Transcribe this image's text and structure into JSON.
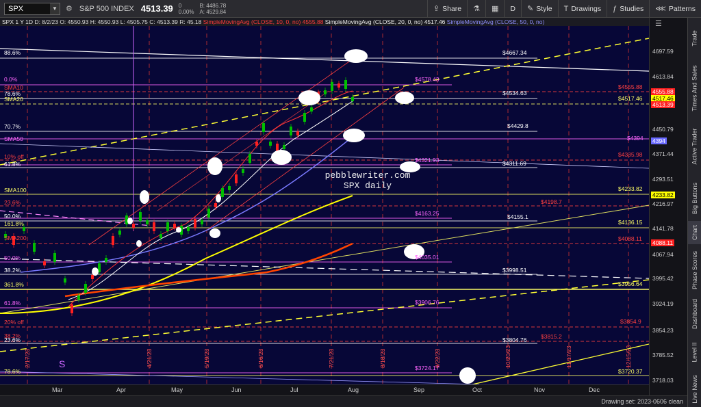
{
  "toolbar": {
    "symbol": "SPX",
    "index_name": "S&P 500 INDEX",
    "price": "4513.39",
    "change": "0",
    "change_pct": "0.00%",
    "bid": "B: 4486.78",
    "ask": "A: 4529.84",
    "share_label": "Share",
    "period_label": "D",
    "style_label": "Style",
    "drawings_label": "Drawings",
    "studies_label": "Studies",
    "patterns_label": "Patterns"
  },
  "header": {
    "instrument": "SPX 1 Y 1D",
    "date": "D: 8/2/23",
    "open": "O: 4550.93",
    "high": "H: 4550.93",
    "low": "L: 4505.75",
    "close": "C: 4513.39",
    "range": "R: 45.18",
    "sma10_label": "SimpleMovingAvg (CLOSE, 10, 0, no)",
    "sma10_value": "4555.88",
    "sma20_label": "SimpleMovingAvg (CLOSE, 20, 0, no)",
    "sma20_value": "4517.46",
    "sma50_label": "SimpleMovingAvg (CLOSE, 50, 0, no)"
  },
  "watermark": {
    "site": "pebblewriter.com",
    "subtitle": "SPX daily",
    "s_marker": "S"
  },
  "left_labels": {
    "fib886": "88.6%",
    "fib0": "0.0%",
    "sma10": "SMA10",
    "fib786": "78.6%",
    "sma20": "SMA20",
    "fib707": "70.7%",
    "sma50": "SMA50",
    "off10": "10% off",
    "fib618a": "61.8%",
    "sma100": "SMA100",
    "fib236a": "23.6%",
    "fib500": "50.0%",
    "fib1618": "161.8%",
    "sma200": "SMA200",
    "fib50b": "50.0%",
    "fib382": "38.2%",
    "fib3618": "361.8%",
    "fib618b": "61.8%",
    "off20": "20% off",
    "fib382b": "38.2%",
    "fib236b": "23.6%",
    "fib786b": "78.6%"
  },
  "level_labels": [
    {
      "text": "$4667.34",
      "color": "#ffffff"
    },
    {
      "text": "$4578.43",
      "color": "#ff66ff"
    },
    {
      "text": "$4555.88",
      "color": "#ff4040"
    },
    {
      "text": "$4534.63",
      "color": "#ffffff"
    },
    {
      "text": "$4517.46",
      "color": "#ffff66"
    },
    {
      "text": "$4429.8",
      "color": "#ffffff"
    },
    {
      "text": "$4394",
      "color": "#ff66ff"
    },
    {
      "text": "$4335.98",
      "color": "#ff4040"
    },
    {
      "text": "$4321.93",
      "color": "#ff66ff"
    },
    {
      "text": "$4311.69",
      "color": "#ffffff"
    },
    {
      "text": "$4233.82",
      "color": "#ffff66"
    },
    {
      "text": "$4198.7",
      "color": "#ff4040"
    },
    {
      "text": "$4163.25",
      "color": "#ff66ff"
    },
    {
      "text": "$4155.1",
      "color": "#ffffff"
    },
    {
      "text": "$4136.15",
      "color": "#ffff66"
    },
    {
      "text": "$4088.11",
      "color": "#ff4040"
    },
    {
      "text": "$4035.01",
      "color": "#ff66ff"
    },
    {
      "text": "$3998.51",
      "color": "#ffffff"
    },
    {
      "text": "$3956.64",
      "color": "#ffff66"
    },
    {
      "text": "$3906.76",
      "color": "#ff66ff"
    },
    {
      "text": "$3854.9",
      "color": "#ff4040"
    },
    {
      "text": "$3815.2",
      "color": "#ff4040"
    },
    {
      "text": "$3804.76",
      "color": "#ffffff"
    },
    {
      "text": "$3724.17",
      "color": "#ff66ff"
    },
    {
      "text": "$3720.37",
      "color": "#ffff66"
    }
  ],
  "price_axis": [
    "4697.59",
    "4613.84",
    "4531.58",
    "4450.79",
    "4371.44",
    "4293.51",
    "4216.97",
    "4141.78",
    "4067.94",
    "3995.42",
    "3924.19",
    "3854.23",
    "3785.52",
    "3718.03"
  ],
  "price_tags": [
    {
      "text": "4555.88",
      "bg": "#ff2020",
      "fg": "#ffffff"
    },
    {
      "text": "4517.46",
      "bg": "#ffff00",
      "fg": "#000000"
    },
    {
      "text": "4513.39",
      "bg": "#ff2020",
      "fg": "#ffffff"
    },
    {
      "text": "4394",
      "bg": "#6a6aff",
      "fg": "#ffffff"
    },
    {
      "text": "4233.82",
      "bg": "#ffff00",
      "fg": "#000000"
    },
    {
      "text": "4088.11",
      "bg": "#ff2020",
      "fg": "#ffffff"
    }
  ],
  "vertical_dates": [
    "2/17/23",
    "4/21/23",
    "5/19/23",
    "6/16/23",
    "7/21/23",
    "8/18/23",
    "9/22/23",
    "10/20/23",
    "11/17/23",
    "12/15/23"
  ],
  "time_axis": [
    "Mar",
    "Apr",
    "May",
    "Jun",
    "Jul",
    "Aug",
    "Sep",
    "Oct",
    "Nov",
    "Dec"
  ],
  "side_tabs": [
    "Trade",
    "Times And Sales",
    "Active Trader",
    "Big Buttons",
    "Chart",
    "Phase Scores",
    "Dashboard",
    "Level II",
    "Live News"
  ],
  "footer": {
    "drawing_set": "Drawing set: 2023-0606 clean"
  },
  "colors": {
    "chart_bg": "#070737",
    "sma10": "#ff3333",
    "sma20": "#ffffff",
    "sma50": "#7a7aff",
    "sma100": "#ffff00",
    "sma200": "#ff4400",
    "fib_purple": "#ff66ff",
    "yellow_channel": "#ffff33"
  }
}
